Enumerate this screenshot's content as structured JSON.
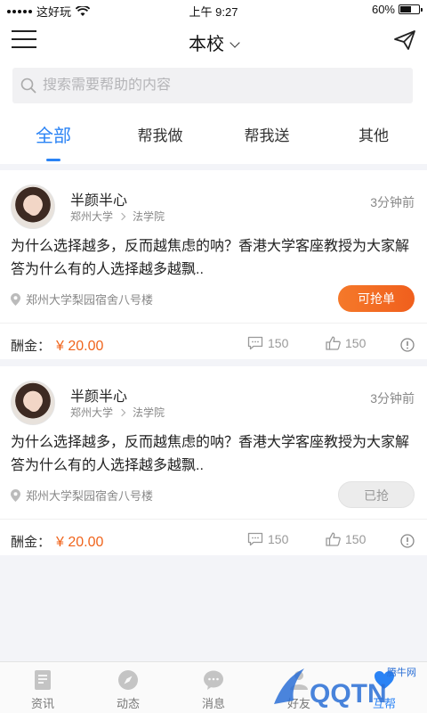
{
  "status": {
    "carrier": "这好玩",
    "time": "上午 9:27",
    "battery": "60%"
  },
  "nav": {
    "title": "本校"
  },
  "search": {
    "placeholder": "搜索需要帮助的内容"
  },
  "tabs": [
    {
      "label": "全部",
      "active": true
    },
    {
      "label": "帮我做"
    },
    {
      "label": "帮我送"
    },
    {
      "label": "其他"
    }
  ],
  "posts": [
    {
      "user": "半颜半心",
      "school": "郑州大学",
      "department": "法学院",
      "time": "3分钟前",
      "content": "为什么选择越多，反而越焦虑的呐？香港大学客座教授为大家解答为什么有的人选择越多越飘..",
      "location": "郑州大学梨园宿舍八号楼",
      "button": "可抢单",
      "reward_label": "酬金：",
      "reward": "¥ 20.00",
      "comments": "150",
      "likes": "150"
    },
    {
      "user": "半颜半心",
      "school": "郑州大学",
      "department": "法学院",
      "time": "3分钟前",
      "content": "为什么选择越多，反而越焦虑的呐？香港大学客座教授为大家解答为什么有的人选择越多越飘..",
      "location": "郑州大学梨园宿舍八号楼",
      "button": "已抢",
      "reward_label": "酬金：",
      "reward": "¥ 20.00",
      "comments": "150",
      "likes": "150"
    }
  ],
  "tabbar": [
    {
      "label": "资讯",
      "icon": "news-icon"
    },
    {
      "label": "动态",
      "icon": "compass-icon"
    },
    {
      "label": "消息",
      "icon": "message-icon"
    },
    {
      "label": "好友",
      "icon": "friends-icon"
    },
    {
      "label": "互帮",
      "icon": "help-icon"
    }
  ],
  "watermark": {
    "label": "腾牛网",
    "text": "QQTN"
  },
  "colors": {
    "accent": "#2a83f5",
    "orange": "#f0641c"
  }
}
